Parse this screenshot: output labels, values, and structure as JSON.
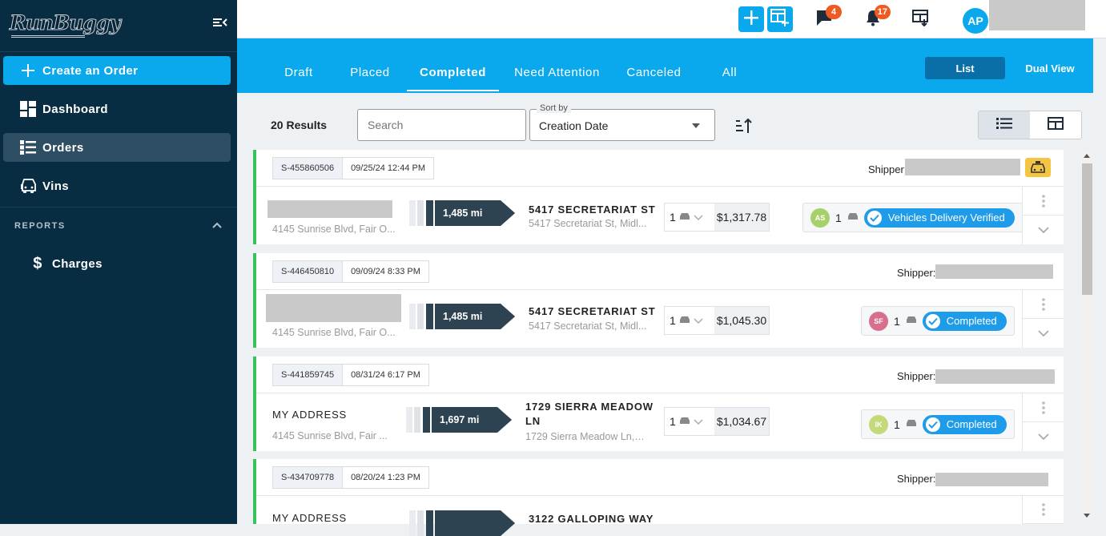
{
  "sidebar": {
    "logo": "RunBuggy",
    "create_label": "Create an Order",
    "items": [
      {
        "label": "Dashboard"
      },
      {
        "label": "Orders"
      },
      {
        "label": "Vins"
      }
    ],
    "reports_label": "REPORTS",
    "charges_label": "Charges"
  },
  "topbar": {
    "messages_count": "4",
    "notifications_count": "17",
    "user_initials": "AP"
  },
  "tabs": [
    "Draft",
    "Placed",
    "Completed",
    "Need Attention",
    "Canceled",
    "All"
  ],
  "active_tab": "Completed",
  "view": {
    "list_label": "List",
    "dual_label": "Dual View"
  },
  "toolbar": {
    "results": "20 Results",
    "search_placeholder": "Search",
    "sort_legend": "Sort by",
    "sort_value": "Creation Date"
  },
  "orders": [
    {
      "id": "S-455860506",
      "date": "09/25/24 12:44 PM",
      "shipper_label": "Shipper:",
      "origin_name": "",
      "origin_addr": "4145 Sunrise Blvd, Fair O...",
      "distance": "1,485 mi",
      "dest_name": "5417 SECRETARIAT ST",
      "dest_addr": "5417 Secretariat St, Midl...",
      "qty": "1",
      "price": "$1,317.78",
      "driver": "AS",
      "driver_color": "#a8cf6a",
      "vehicles": "1",
      "status": "Vehicles Delivery Verified"
    },
    {
      "id": "S-446450810",
      "date": "09/09/24 8:33 PM",
      "shipper_label": "Shipper:",
      "origin_name": "",
      "origin_addr": "4145 Sunrise Blvd, Fair O...",
      "distance": "1,485 mi",
      "dest_name": "5417 SECRETARIAT ST",
      "dest_addr": "5417 Secretariat St, Midl...",
      "qty": "1",
      "price": "$1,045.30",
      "driver": "SF",
      "driver_color": "#d86f8c",
      "vehicles": "1",
      "status": "Completed"
    },
    {
      "id": "S-441859745",
      "date": "08/31/24 6:17 PM",
      "shipper_label": "Shipper:",
      "origin_name": "MY ADDRESS",
      "origin_addr": "4145 Sunrise Blvd, Fair ...",
      "distance": "1,697 mi",
      "dest_name": "1729 SIERRA MEADOW LN",
      "dest_addr": "1729 Sierra Meadow Ln, J...",
      "qty": "1",
      "price": "$1,034.67",
      "driver": "IK",
      "driver_color": "#c3d97a",
      "vehicles": "1",
      "status": "Completed"
    },
    {
      "id": "S-434709778",
      "date": "08/20/24 1:23 PM",
      "shipper_label": "Shipper:",
      "origin_name": "MY ADDRESS",
      "origin_addr": "",
      "distance": "",
      "dest_name": "3122 GALLOPING WAY",
      "dest_addr": "",
      "qty": "",
      "price": "",
      "driver": "",
      "driver_color": "#cccccc",
      "vehicles": "",
      "status": ""
    }
  ]
}
